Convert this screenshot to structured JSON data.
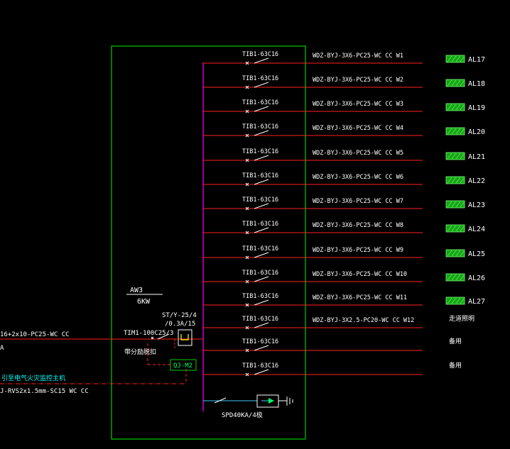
{
  "diagram": {
    "panel": {
      "name": "AW3",
      "power": "6KW"
    },
    "incoming": {
      "cable": "16+2x10-PC25-WC CC",
      "cable_suffix": "A",
      "breaker": "TIM1-100C25/3",
      "breaker_note": "带分励脱扣",
      "st_label": "ST/Y-25/4",
      "st_rating": "/0.3A/15",
      "module": "QJ-M2"
    },
    "fire": {
      "note": "引至电气火灾监控主机",
      "cable": "J-RVS2x1.5mm-SC15 WC CC"
    },
    "spd": "SPD40KA/4极",
    "circuits": [
      {
        "breaker": "TIB1-63C16",
        "cable": "WDZ-BYJ-3X6-PC25-WC CC W1",
        "dest": "AL17"
      },
      {
        "breaker": "TIB1-63C16",
        "cable": "WDZ-BYJ-3X6-PC25-WC CC W2",
        "dest": "AL18"
      },
      {
        "breaker": "TIB1-63C16",
        "cable": "WDZ-BYJ-3X6-PC25-WC CC W3",
        "dest": "AL19"
      },
      {
        "breaker": "TIB1-63C16",
        "cable": "WDZ-BYJ-3X6-PC25-WC CC W4",
        "dest": "AL20"
      },
      {
        "breaker": "TIB1-63C16",
        "cable": "WDZ-BYJ-3X6-PC25-WC CC W5",
        "dest": "AL21"
      },
      {
        "breaker": "TIB1-63C16",
        "cable": "WDZ-BYJ-3X6-PC25-WC CC W6",
        "dest": "AL22"
      },
      {
        "breaker": "TIB1-63C16",
        "cable": "WDZ-BYJ-3X6-PC25-WC CC W7",
        "dest": "AL23"
      },
      {
        "breaker": "TIB1-63C16",
        "cable": "WDZ-BYJ-3X6-PC25-WC CC W8",
        "dest": "AL24"
      },
      {
        "breaker": "TIB1-63C16",
        "cable": "WDZ-BYJ-3X6-PC25-WC CC W9",
        "dest": "AL25"
      },
      {
        "breaker": "TIB1-63C16",
        "cable": "WDZ-BYJ-3X6-PC25-WC CC W10",
        "dest": "AL26"
      },
      {
        "breaker": "TIB1-63C16",
        "cable": "WDZ-BYJ-3X6-PC25-WC CC W11",
        "dest": "AL27"
      },
      {
        "breaker": "TIB1-63C16",
        "cable": "WDZ-BYJ-3X2.5-PC20-WC CC W12",
        "dest": "走道照明"
      },
      {
        "breaker": "TIB1-63C16",
        "cable": "",
        "dest": "备用"
      },
      {
        "breaker": "TIB1-63C16",
        "cable": "",
        "dest": "备用"
      }
    ],
    "colors": {
      "background": "#000000",
      "enclosure": "#00cc00",
      "feeder": "#ff2020",
      "busbar": "#ff00ff",
      "text": "#ffffff",
      "tag_fill": "#16a616",
      "spd": "#40c8ff",
      "device": "#ffff00",
      "fire_line": "#00ffff"
    }
  }
}
